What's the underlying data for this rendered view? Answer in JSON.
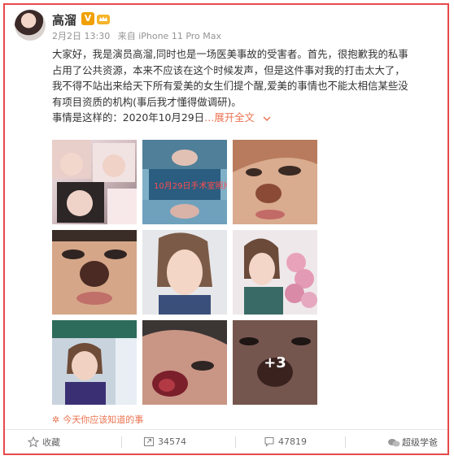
{
  "post": {
    "author": "高溜",
    "v_badge": "V",
    "date": "2月2日 13:30",
    "source": "来自 iPhone 11 Pro Max",
    "text_lines": [
      "大家好，我是演员高溜,同时也是一场医美事故的受害者。首先，很抱歉我的私事",
      "占用了公共资源，本来不应该在这个时候发声，但是这件事对我的打击太大了，",
      "我不得不站出来给天下所有爱美的女生们提个醒,爱美的事情也不能太相信某些没",
      "有项目资质的机构(事后我才懂得做调研)。"
    ],
    "last_line": "事情是这样的：2020年10月29日",
    "expand_label": "展开全文",
    "expand_icon": "chevron-down-icon",
    "image_overlay_texts": [
      "10月29日手术室照片",
      "+3"
    ],
    "topic_text": "今天你应该知道的事",
    "topic_icon": "topic-flower-icon"
  },
  "actions": {
    "favorite_label": "收藏",
    "repost_count": "34574",
    "comment_count": "47819",
    "watermark": "超级学爸"
  },
  "colors": {
    "frame_border": "#e8494b",
    "link": "#eb7350",
    "badge": "#f0a000"
  }
}
